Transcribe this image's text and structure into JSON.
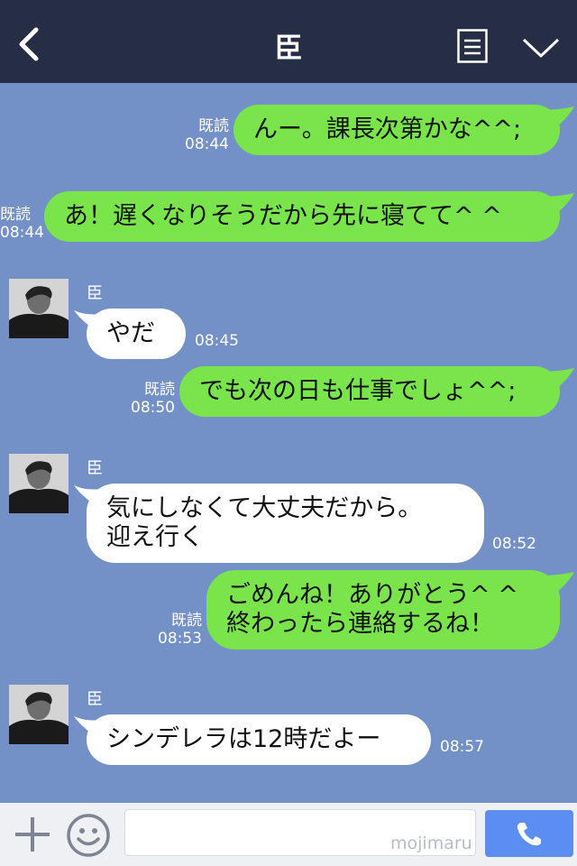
{
  "header": {
    "title": "臣",
    "back_icon": "chevron-left-icon",
    "menu_icon": "list-icon",
    "collapse_icon": "chevron-down-icon",
    "background": "#252e45"
  },
  "chat": {
    "background": "#7391c6",
    "colors": {
      "outgoing": "#79e54b",
      "incoming": "#ffffff"
    },
    "messages": [
      {
        "side": "out",
        "text": "んー。課長次第かな^^;",
        "read": "既読",
        "time": "08:44"
      },
      {
        "side": "out",
        "text": "あ！遅くなりそうだから先に寝てて^ ^",
        "read": "既読",
        "time": "08:44"
      },
      {
        "side": "in",
        "sender": "臣",
        "text": "やだ",
        "time": "08:45"
      },
      {
        "side": "out",
        "text": "でも次の日も仕事でしょ^^;",
        "read": "既読",
        "time": "08:50"
      },
      {
        "side": "in",
        "sender": "臣",
        "text": "気にしなくて大丈夫だから。\n迎え行く",
        "time": "08:52"
      },
      {
        "side": "out",
        "text": "ごめんね！ありがとう^ ^\n終わったら連絡するね！",
        "read": "既読",
        "time": "08:53"
      },
      {
        "side": "in",
        "sender": "臣",
        "text": "シンデレラは12時だよー",
        "time": "08:57"
      }
    ]
  },
  "input": {
    "plus_icon": "plus-icon",
    "sticker_icon": "smiley-icon",
    "watermark": "mojimaru",
    "call_icon": "phone-icon",
    "call_color": "#5b8ef0"
  }
}
